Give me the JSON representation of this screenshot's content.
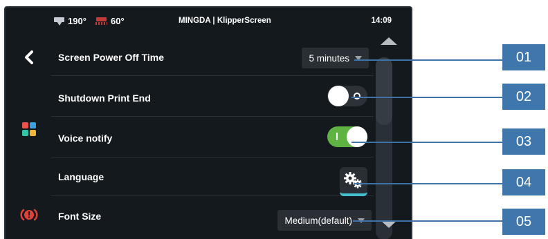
{
  "status_bar": {
    "extruder_temp": "190°",
    "bed_temp": "60°",
    "title": "MINGDA  | KlipperScreen",
    "time": "14:09"
  },
  "nav": {
    "back_icon": "chevron-left-icon",
    "menu_icon": "grid-menu-icon",
    "estop_icon": "emergency-stop-icon"
  },
  "settings": [
    {
      "label": "Screen Power Off Time",
      "control": "dropdown",
      "value": "5 minutes"
    },
    {
      "label": "Shutdown Print End",
      "control": "toggle",
      "on": false
    },
    {
      "label": "Voice notify",
      "control": "toggle",
      "on": true
    },
    {
      "label": "Language",
      "control": "button",
      "icon": "gears-icon"
    },
    {
      "label": "Font Size",
      "control": "dropdown",
      "value": "Medium(default)"
    }
  ],
  "callouts": [
    "01",
    "02",
    "03",
    "04",
    "05"
  ],
  "colors": {
    "screen_bg": "#14191d",
    "toggle_on": "#5eb342",
    "accent_cyan": "#45c0cf",
    "callout_blue": "#3f76ac",
    "bed_red": "#c23b3b"
  }
}
